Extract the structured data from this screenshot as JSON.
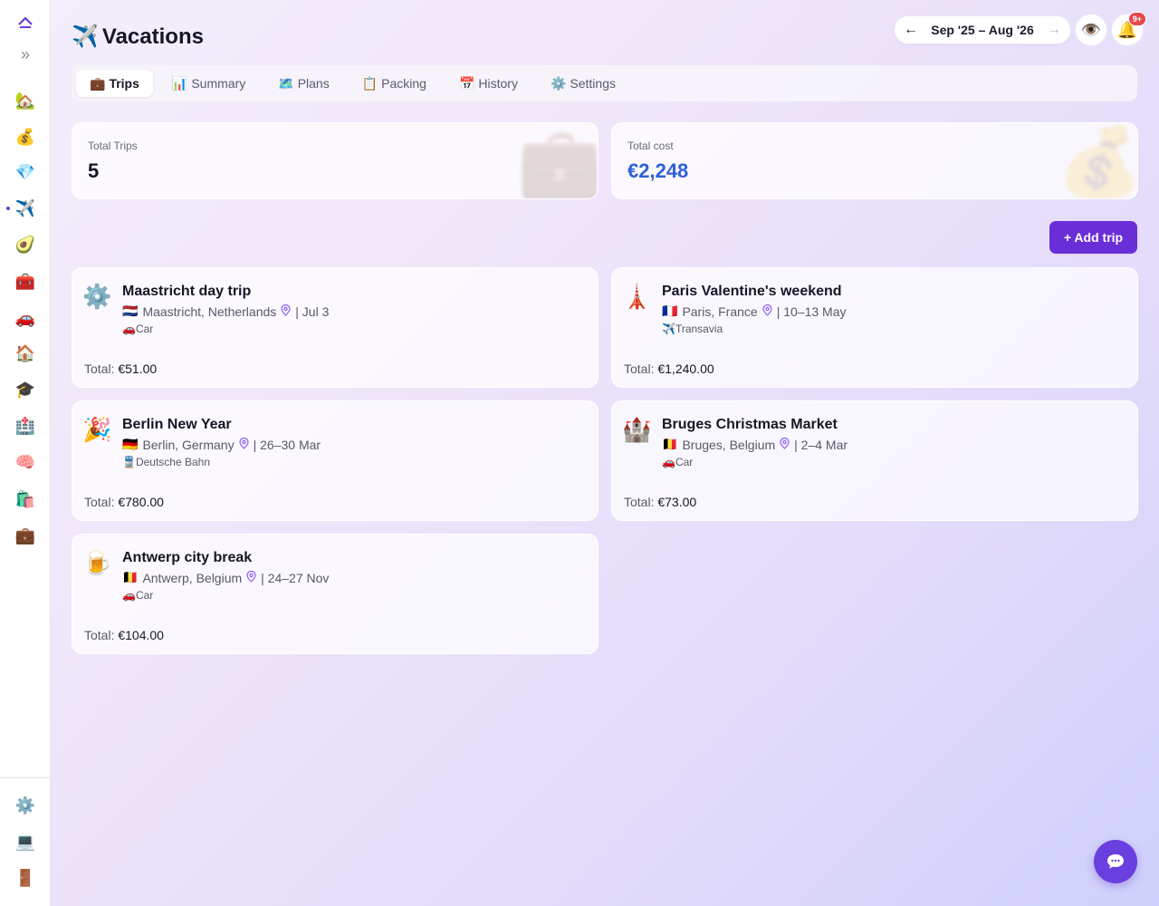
{
  "sidebar": {
    "top": [
      {
        "name": "collapse-up-icon",
        "glyph": "⌃"
      },
      {
        "name": "expand-sidebar-icon",
        "glyph": "»"
      }
    ],
    "items": [
      {
        "name": "sidebar-item-home",
        "glyph": "🏡"
      },
      {
        "name": "sidebar-item-money",
        "glyph": "💰"
      },
      {
        "name": "sidebar-item-gem",
        "glyph": "💎"
      },
      {
        "name": "sidebar-item-vacations",
        "glyph": "✈️",
        "active": true
      },
      {
        "name": "sidebar-item-avocado",
        "glyph": "🥑"
      },
      {
        "name": "sidebar-item-toolbox",
        "glyph": "🧰"
      },
      {
        "name": "sidebar-item-car",
        "glyph": "🚗"
      },
      {
        "name": "sidebar-item-house",
        "glyph": "🏠"
      },
      {
        "name": "sidebar-item-education",
        "glyph": "🎓"
      },
      {
        "name": "sidebar-item-health",
        "glyph": "🏥"
      },
      {
        "name": "sidebar-item-brain",
        "glyph": "🧠"
      },
      {
        "name": "sidebar-item-shopping",
        "glyph": "🛍️"
      },
      {
        "name": "sidebar-item-work",
        "glyph": "💼"
      }
    ],
    "bottom": [
      {
        "name": "sidebar-item-settings",
        "glyph": "⚙️"
      },
      {
        "name": "sidebar-item-laptop",
        "glyph": "💻"
      },
      {
        "name": "sidebar-item-logout",
        "glyph": "🚪"
      }
    ]
  },
  "header": {
    "icon": "✈️",
    "title": "Vacations",
    "period": "Sep '25 – Aug '26",
    "prev_arrow": "←",
    "next_arrow": "→",
    "eye_icon": "👁️",
    "bell_icon": "🔔",
    "notification_badge": "9+"
  },
  "tabs": [
    {
      "icon": "💼",
      "label": "Trips",
      "active": true
    },
    {
      "icon": "📊",
      "label": "Summary"
    },
    {
      "icon": "🗺️",
      "label": "Plans"
    },
    {
      "icon": "📋",
      "label": "Packing"
    },
    {
      "icon": "📅",
      "label": "History"
    },
    {
      "icon": "⚙️",
      "label": "Settings"
    }
  ],
  "stats": {
    "total_trips_label": "Total Trips",
    "total_trips_value": "5",
    "total_trips_bg_icon": "💼",
    "total_cost_label": "Total cost",
    "total_cost_value": "€2,248",
    "total_cost_bg_icon": "💰"
  },
  "add_trip_label": "+ Add trip",
  "trips": [
    {
      "icon": "⚙️",
      "name": "Maastricht day trip",
      "flag": "🇳🇱",
      "location": "Maastricht, Netherlands",
      "dates": "| Jul 3",
      "transport_icon": "🚗",
      "transport": "Car",
      "total_label": "Total:",
      "total": "€51.00"
    },
    {
      "icon": "🗼",
      "name": "Paris Valentine's weekend",
      "flag": "🇫🇷",
      "location": "Paris, France",
      "dates": "| 10–13 May",
      "transport_icon": "✈️",
      "transport": "Transavia",
      "total_label": "Total:",
      "total": "€1,240.00"
    },
    {
      "icon": "🎉",
      "name": "Berlin New Year",
      "flag": "🇩🇪",
      "location": "Berlin, Germany",
      "dates": "| 26–30 Mar",
      "transport_icon": "🚆",
      "transport": "Deutsche Bahn",
      "total_label": "Total:",
      "total": "€780.00"
    },
    {
      "icon": "🏰",
      "name": "Bruges Christmas Market",
      "flag": "🇧🇪",
      "location": "Bruges, Belgium",
      "dates": "| 2–4 Mar",
      "transport_icon": "🚗",
      "transport": "Car",
      "total_label": "Total:",
      "total": "€73.00"
    },
    {
      "icon": "🍺",
      "name": "Antwerp city break",
      "flag": "🇧🇪",
      "location": "Antwerp, Belgium",
      "dates": "| 24–27 Nov",
      "transport_icon": "🚗",
      "transport": "Car",
      "total_label": "Total:",
      "total": "€104.00"
    }
  ],
  "colors": {
    "accent": "#6a2ed8",
    "cost_value": "#2f5fd6",
    "chat_button": "#6a3fe0",
    "badge": "#e5484d"
  }
}
